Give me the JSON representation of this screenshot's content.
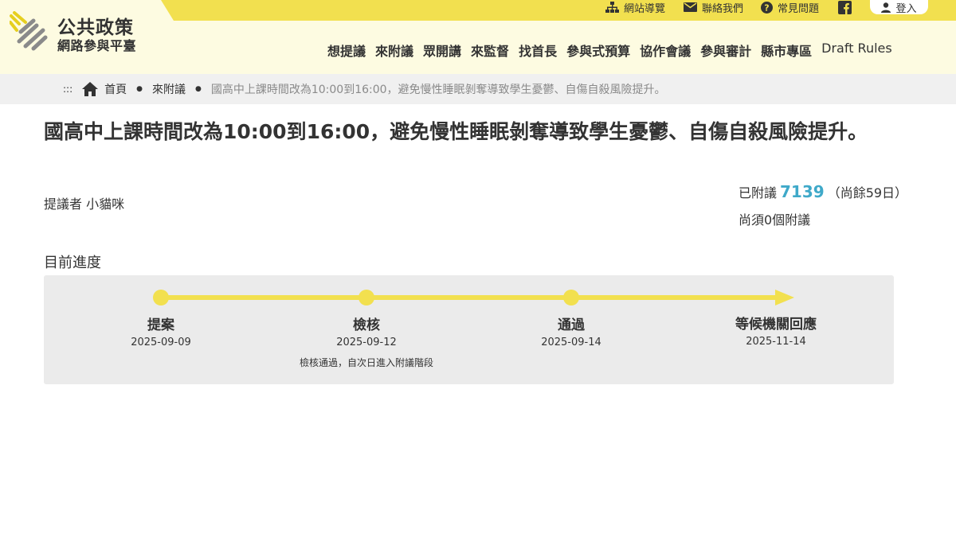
{
  "header": {
    "logo_line1": "公共政策",
    "logo_line2": "網路參與平臺",
    "utility": {
      "sitemap": "網站導覽",
      "contact": "聯絡我們",
      "faq": "常見問題",
      "login": "登入"
    },
    "nav": [
      "想提議",
      "來附議",
      "眾開講",
      "來監督",
      "找首長",
      "參與式預算",
      "協作會議",
      "參與審計",
      "縣市專區",
      "Draft Rules"
    ],
    "colors": {
      "accent": "#f2e04f",
      "header_bg": "#fdfbe1",
      "count": "#3fa9c9"
    }
  },
  "breadcrumb": {
    "dots": ":::",
    "home": "首頁",
    "section": "來附議",
    "current": "國高中上課時間改為10:00到16:00，避免慢性睡眠剝奪導致學生憂鬱、自傷自殺風險提升。"
  },
  "proposal": {
    "title": "國高中上課時間改為10:00到16:00，避免慢性睡眠剝奪導致學生憂鬱、自傷自殺風險提升。",
    "proposer": "提議者 小貓咪",
    "seconded_prefix": "已附議",
    "seconded_count": "7139",
    "remaining_days": "（尚餘59日）",
    "needed": "尚須0個附議"
  },
  "progress": {
    "label": "目前進度",
    "steps": [
      {
        "name": "提案",
        "date": "2025-09-09",
        "note": ""
      },
      {
        "name": "檢核",
        "date": "2025-09-12",
        "note": "檢核通過，自次日進入附議階段"
      },
      {
        "name": "通過",
        "date": "2025-09-14",
        "note": ""
      },
      {
        "name": "等候機關回應",
        "date": "2025-11-14",
        "note": ""
      }
    ]
  }
}
